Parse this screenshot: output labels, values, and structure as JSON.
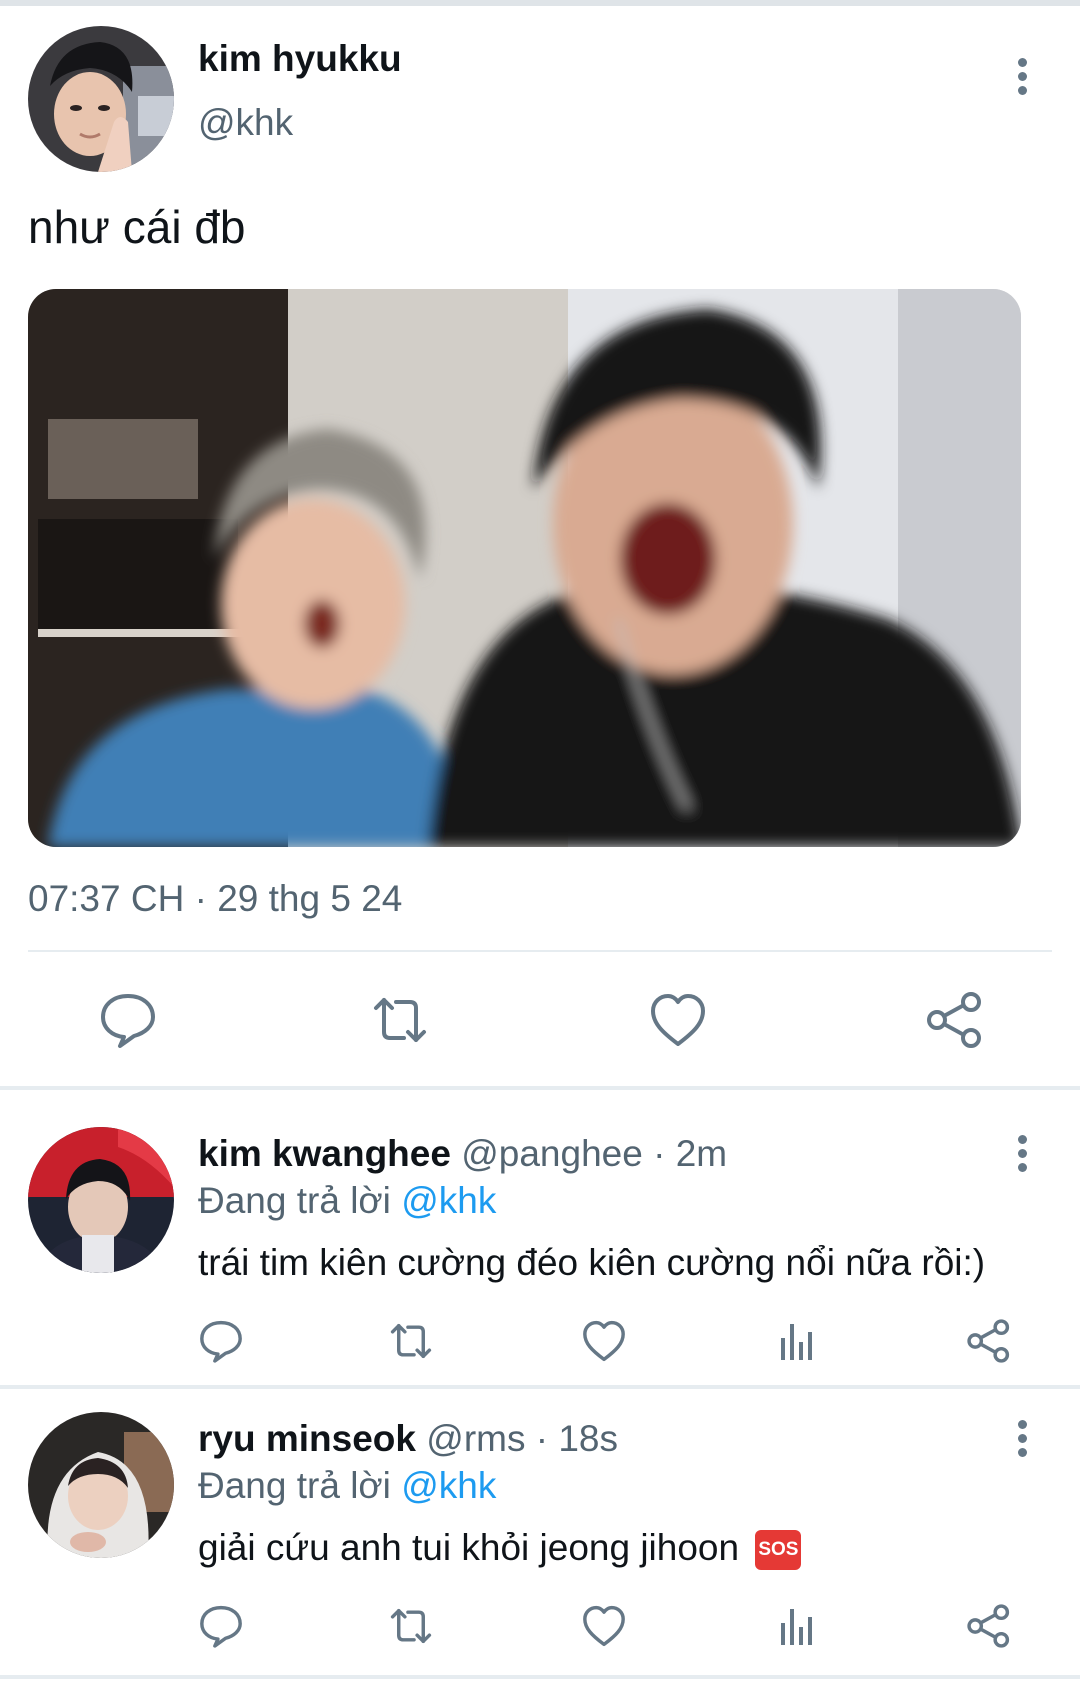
{
  "main_tweet": {
    "author_name": "kim hyukku",
    "author_handle": "@khk",
    "text": "như cái đb",
    "timestamp": "07:37 CH · 29 thg 5 24",
    "icons": [
      "reply-icon",
      "retweet-icon",
      "like-icon",
      "share-icon",
      "more-icon"
    ]
  },
  "replies": [
    {
      "name": "kim kwanghee",
      "handle": "@panghee",
      "time": "· 2m",
      "replying_prefix": "Đang trả lời",
      "mention": "@khk",
      "text": "trái tim kiên cường đéo kiên cường nổi nữa rồi:)",
      "emoji": ""
    },
    {
      "name": "ryu minseok",
      "handle": "@rms",
      "time": "· 18s",
      "replying_prefix": "Đang trả lời",
      "mention": "@khk",
      "text": "giải cứu anh tui khỏi jeong jihoon",
      "emoji": "SOS"
    }
  ],
  "colors": {
    "text": "#0f1419",
    "secondary": "#536471",
    "link": "#1d9bf0",
    "icon": "#657786",
    "divider": "#e6ecf0"
  }
}
